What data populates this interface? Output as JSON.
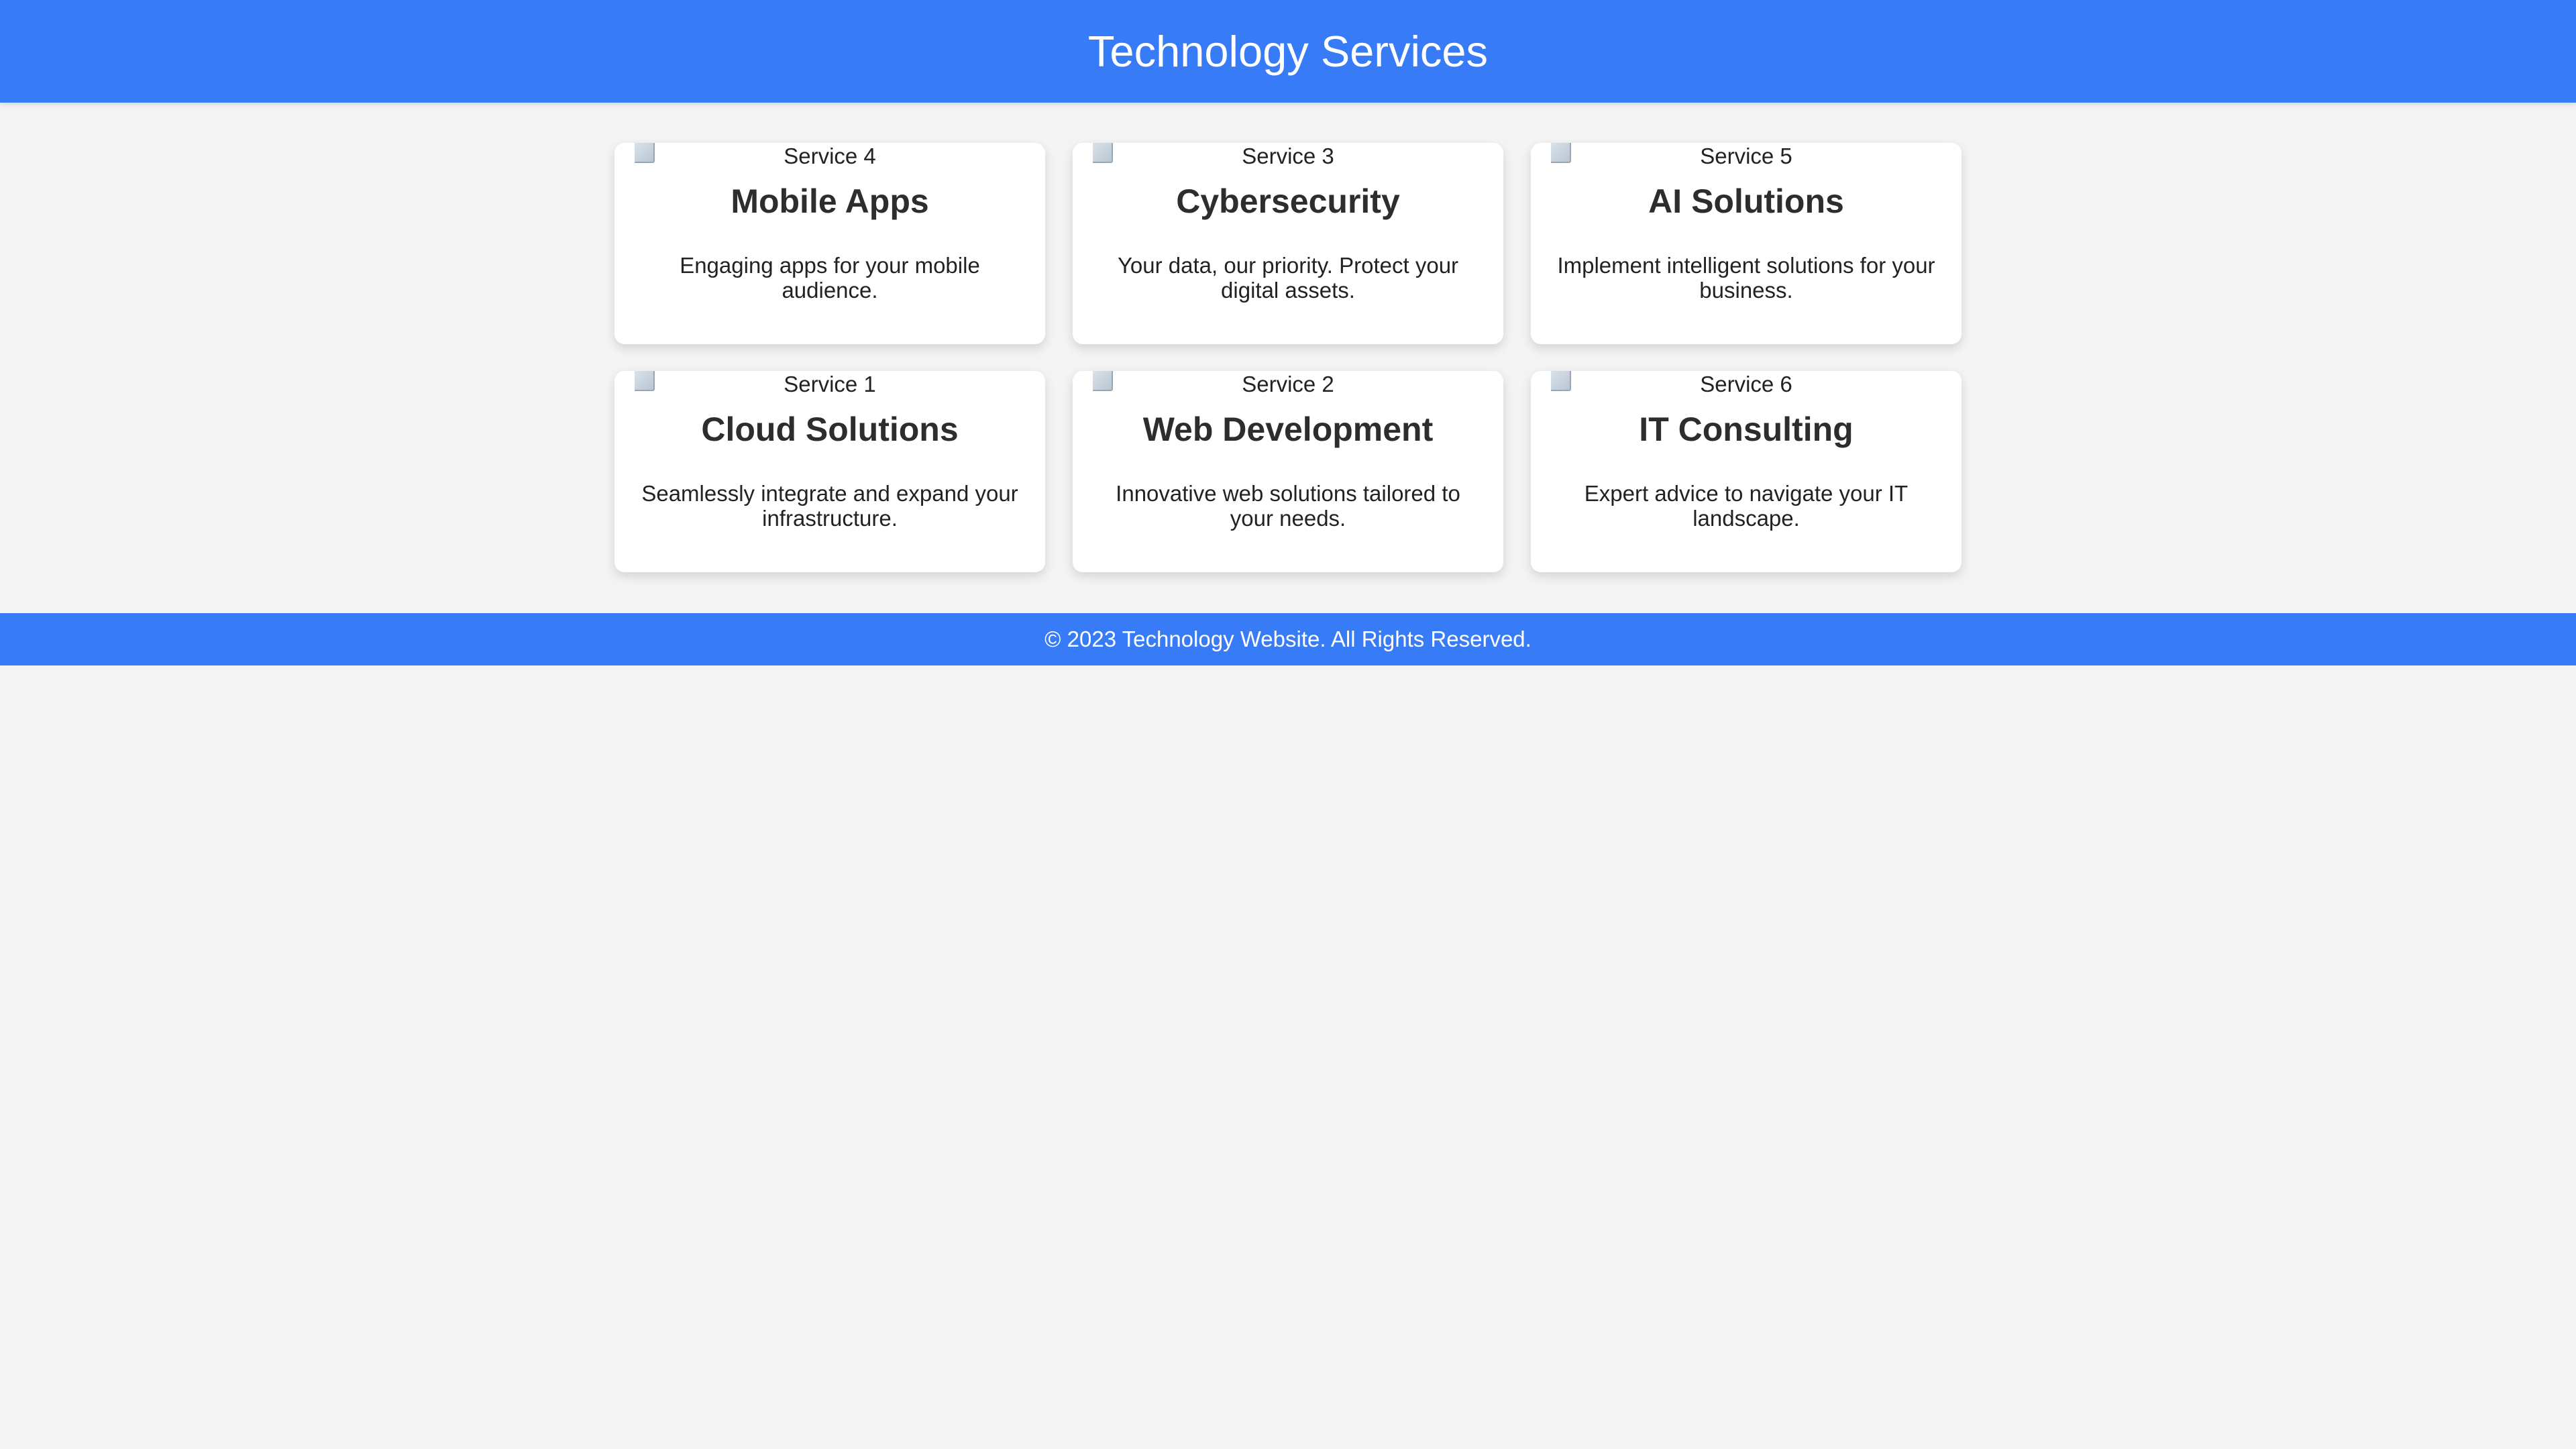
{
  "header": {
    "title": "Technology Services"
  },
  "services": [
    {
      "image_alt": "Service 4",
      "title": "Mobile Apps",
      "description": "Engaging apps for your mobile audience."
    },
    {
      "image_alt": "Service 3",
      "title": "Cybersecurity",
      "description": "Your data, our priority. Protect your digital assets."
    },
    {
      "image_alt": "Service 5",
      "title": "AI Solutions",
      "description": "Implement intelligent solutions for your business."
    },
    {
      "image_alt": "Service 1",
      "title": "Cloud Solutions",
      "description": "Seamlessly integrate and expand your infrastructure."
    },
    {
      "image_alt": "Service 2",
      "title": "Web Development",
      "description": "Innovative web solutions tailored to your needs."
    },
    {
      "image_alt": "Service 6",
      "title": "IT Consulting",
      "description": "Expert advice to navigate your IT landscape."
    }
  ],
  "footer": {
    "text": "© 2023 Technology Website. All Rights Reserved."
  },
  "colors": {
    "brand": "#377bf7",
    "background": "#f4f4f4",
    "card": "#ffffff"
  }
}
